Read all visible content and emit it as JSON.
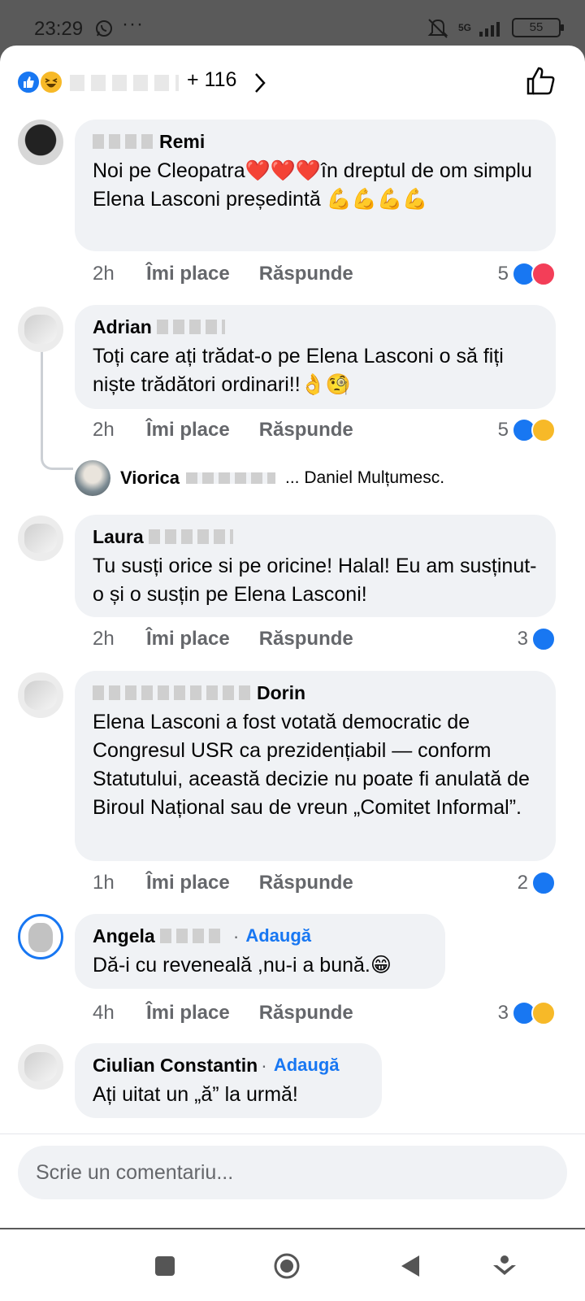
{
  "status_bar": {
    "time": "23:29",
    "dots": "···",
    "network": "5G",
    "battery": "55"
  },
  "header": {
    "reaction_count": "+ 116"
  },
  "comments": [
    {
      "author_visible": "Remi",
      "text": "Noi pe Cleopatra❤️❤️❤️în dreptul de om simplu Elena Lasconi președintă 💪💪💪💪",
      "time": "2h",
      "like_label": "Îmi place",
      "reply_label": "Răspunde",
      "reaction_count": "5"
    },
    {
      "author_visible": "Adrian",
      "text": "Toți care ați trădat-o pe Elena Lasconi o să fiți niște trădători ordinari!!👌🧐",
      "time": "2h",
      "like_label": "Îmi place",
      "reply_label": "Răspunde",
      "reaction_count": "5",
      "reply": {
        "author_visible": "Viorica",
        "text": "... Daniel Mulțumesc."
      }
    },
    {
      "author_visible": "Laura",
      "text": "Tu susți orice si pe oricine! Halal! Eu am susținut- o și o susțin pe Elena Lasconi!",
      "time": "2h",
      "like_label": "Îmi place",
      "reply_label": "Răspunde",
      "reaction_count": "3"
    },
    {
      "author_visible": "Dorin",
      "text": "Elena Lasconi a fost votată democratic de Congresul USR ca prezidențiabil — conform Statutului, această decizie nu poate fi anulată de Biroul Național sau de vreun „Comitet Informal”.",
      "time": "1h",
      "like_label": "Îmi place",
      "reply_label": "Răspunde",
      "reaction_count": "2"
    },
    {
      "author_visible": "Angela",
      "add_label": "Adaugă",
      "text": "Dă-i cu reveneală ,nu-i a bună.😁",
      "time": "4h",
      "like_label": "Îmi place",
      "reply_label": "Răspunde",
      "reaction_count": "3"
    },
    {
      "author_visible": "Ciulian Constantin",
      "add_label": "Adaugă",
      "text": "Ați uitat un „ă” la urmă!"
    }
  ],
  "input": {
    "placeholder": "Scrie un comentariu..."
  },
  "colors": {
    "accent": "#1877f2",
    "bubble": "#f0f2f5",
    "secondary_text": "#65676b",
    "love": "#f33e58"
  },
  "icons": [
    "whatsapp-icon",
    "silent-icon",
    "signal-icon",
    "battery-icon",
    "like-reaction-icon",
    "haha-reaction-icon",
    "love-reaction-icon",
    "sad-reaction-icon",
    "chevron-right-icon",
    "thumbs-up-icon",
    "recents-icon",
    "home-icon",
    "back-icon",
    "assistant-icon"
  ]
}
